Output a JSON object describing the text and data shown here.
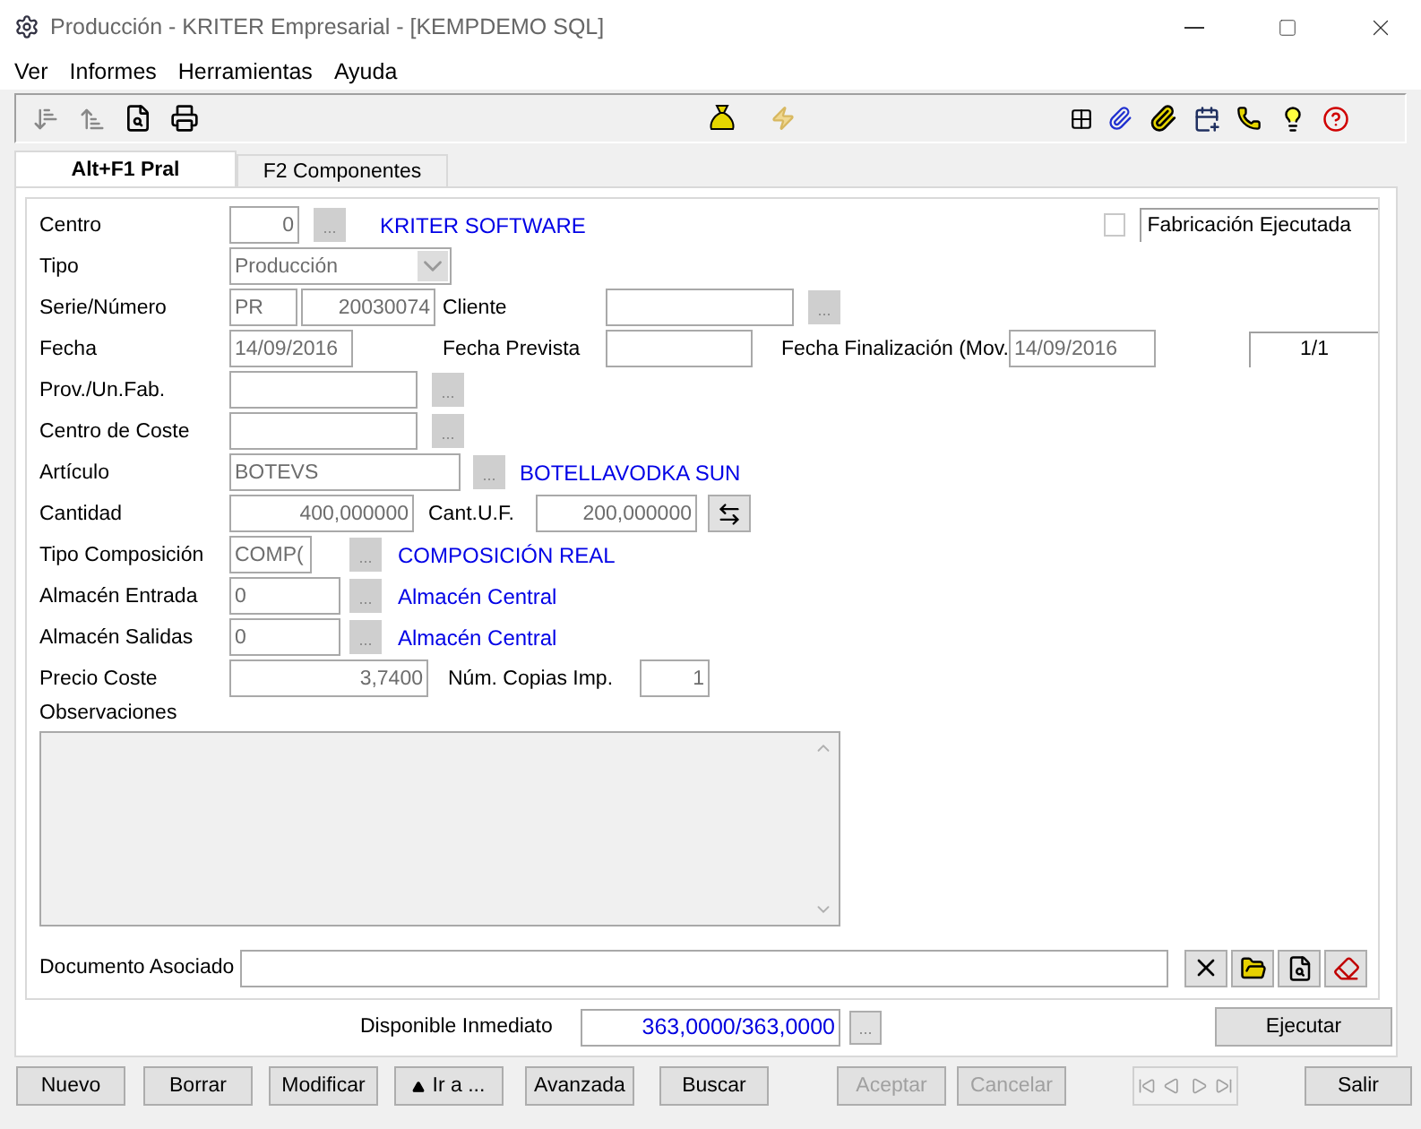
{
  "window": {
    "title": "Producción - KRITER Empresarial  - [KEMPDEMO SQL]"
  },
  "menu": [
    "Ver",
    "Informes",
    "Herramientas",
    "Ayuda"
  ],
  "tabs": [
    {
      "label": "Alt+F1 Pral",
      "selected": true
    },
    {
      "label": "F2 Componentes",
      "selected": false
    }
  ],
  "form": {
    "centro": {
      "label": "Centro",
      "value": "0",
      "link": "KRITER SOFTWARE"
    },
    "fabricacion": {
      "label": "Fabricación Ejecutada",
      "checked": false
    },
    "tipo": {
      "label": "Tipo",
      "value": "Producción"
    },
    "serie": {
      "label": "Serie/Número",
      "serie": "PR",
      "numero": "20030074"
    },
    "cliente": {
      "label": "Cliente"
    },
    "fecha": {
      "label": "Fecha",
      "value": "14/09/2016"
    },
    "fecha_prevista": {
      "label": "Fecha Prevista"
    },
    "fecha_finalizacion": {
      "label": "Fecha Finalización (Mov.",
      "value": "14/09/2016"
    },
    "pagina": "1/1",
    "prov": {
      "label": "Prov./Un.Fab."
    },
    "centro_coste": {
      "label": "Centro de Coste"
    },
    "articulo": {
      "label": "Artículo",
      "value": "BOTEVS",
      "link": "BOTELLAVODKA SUN"
    },
    "cantidad": {
      "label": "Cantidad",
      "value": "400,000000"
    },
    "cant_uf": {
      "label": "Cant.U.F.",
      "value": "200,000000"
    },
    "tipo_composicion": {
      "label": "Tipo Composición",
      "value": "COMP(",
      "link": "COMPOSICIÓN REAL"
    },
    "almacen_entrada": {
      "label": "Almacén Entrada",
      "value": "0",
      "link": "Almacén Central"
    },
    "almacen_salidas": {
      "label": "Almacén Salidas",
      "value": "0",
      "link": "Almacén Central"
    },
    "precio_coste": {
      "label": "Precio Coste",
      "value": "3,7400"
    },
    "copias": {
      "label": "Núm. Copias Imp.",
      "value": "1"
    },
    "observaciones": {
      "label": "Observaciones"
    },
    "documento": {
      "label": "Documento Asociado"
    }
  },
  "ellipsis": "...",
  "disponible": {
    "label": "Disponible Inmediato",
    "value": "363,0000/363,0000"
  },
  "ejecutar": "Ejecutar",
  "buttons": [
    {
      "label": "Nuevo",
      "disabled": false
    },
    {
      "label": "Borrar",
      "disabled": false
    },
    {
      "label": "Modificar",
      "disabled": false
    },
    {
      "label": "Ir a ...",
      "disabled": false,
      "kind": "menu"
    },
    {
      "label": "Avanzada",
      "disabled": false
    },
    {
      "label": "Buscar",
      "disabled": false
    },
    {
      "label": "Aceptar",
      "disabled": true
    },
    {
      "label": "Cancelar",
      "disabled": true
    }
  ],
  "close": "Salir"
}
